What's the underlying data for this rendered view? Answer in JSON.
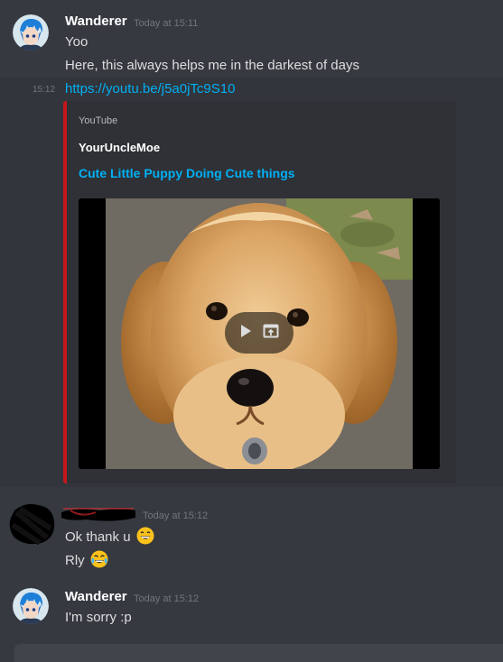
{
  "messages": [
    {
      "author": "Wanderer",
      "timestamp": "Today at 15:11",
      "lines": [
        "Yoo",
        "Here, this always helps me in the darkest of days"
      ]
    },
    {
      "side_time": "15:12",
      "link": "https://youtu.be/j5a0jTc9S10",
      "embed": {
        "provider": "YouTube",
        "author": "YourUncleMoe",
        "title": "Cute Little Puppy Doing Cute things",
        "accent": "#c4161c"
      }
    },
    {
      "author": "",
      "timestamp": "Today at 15:12",
      "lines": [
        "Ok thank u",
        "Rly"
      ],
      "emojis": [
        "grinning-face-emoji",
        "tears-of-joy-emoji"
      ]
    },
    {
      "author": "Wanderer",
      "timestamp": "Today at 15:12",
      "lines": [
        "I'm sorry :p"
      ]
    }
  ],
  "colors": {
    "background": "#36393f",
    "embed_bg": "#2f3136",
    "link": "#00b0f4",
    "timestamp": "#72767d"
  }
}
